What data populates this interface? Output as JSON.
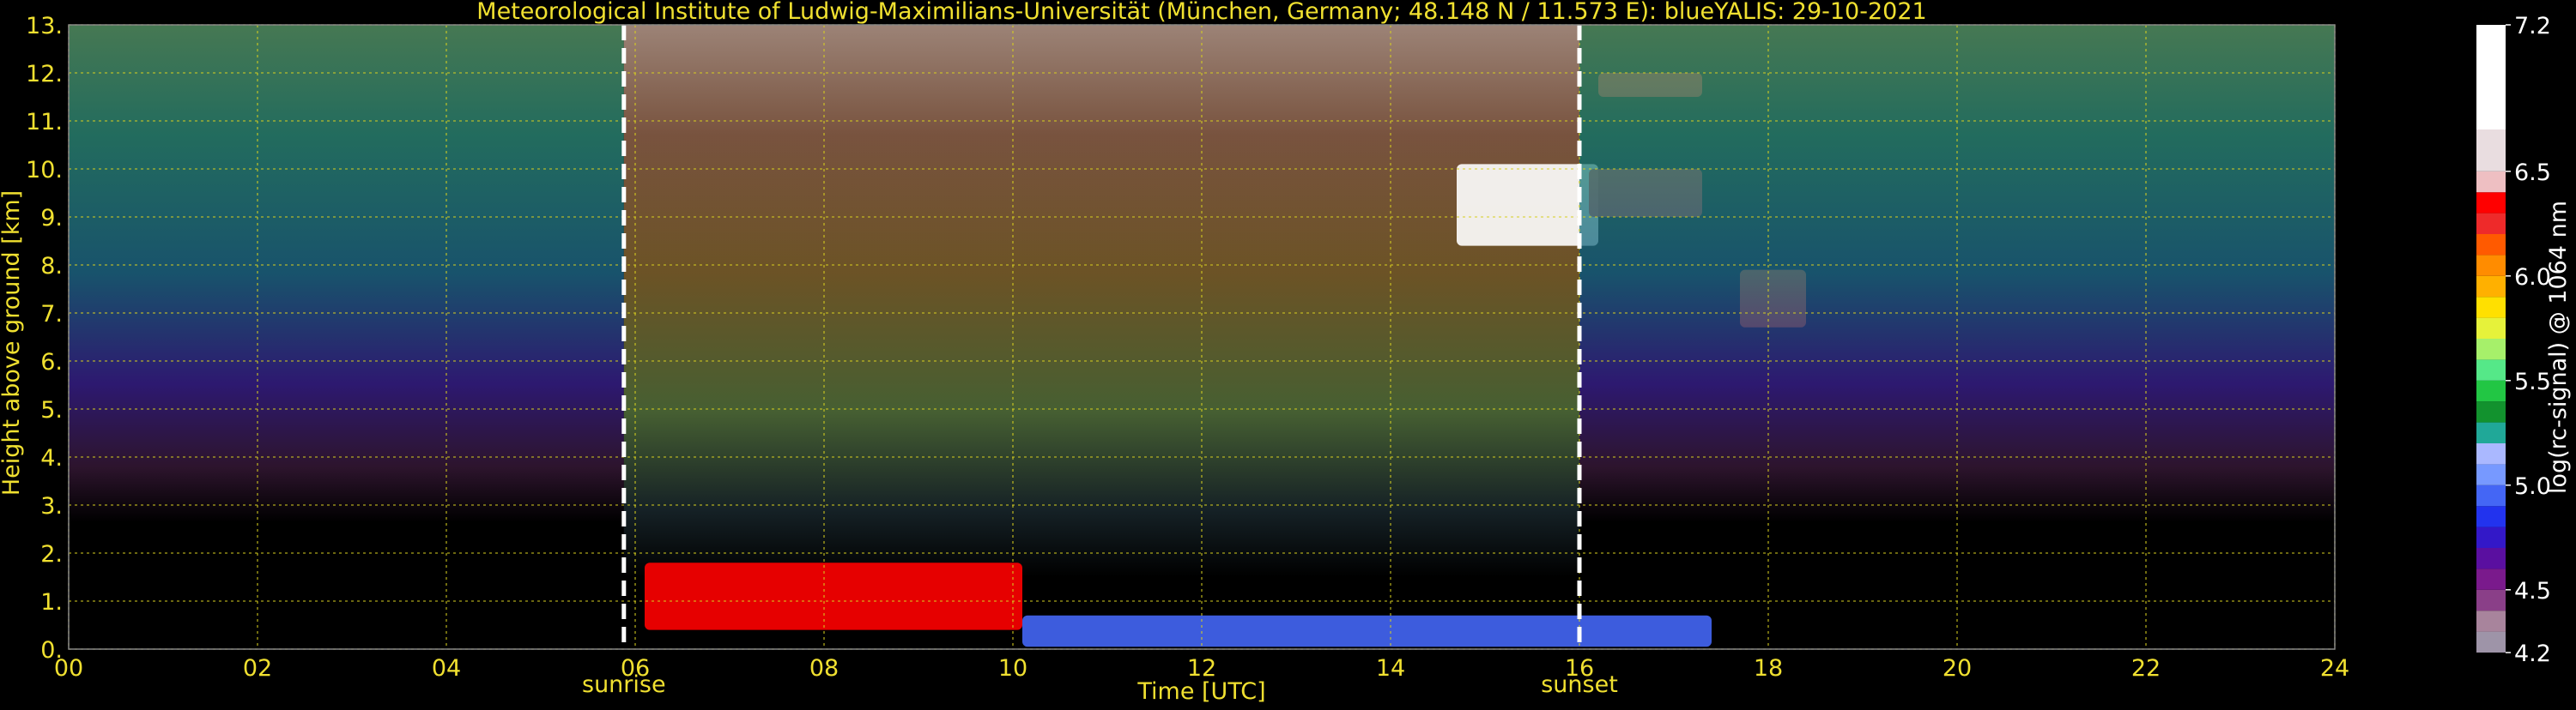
{
  "chart_data": {
    "type": "heatmap",
    "title": "Meteorological Institute of Ludwig-Maximilians-Universität (München, Germany; 48.148 N / 11.573 E):     blueYALIS: 29-10-2021",
    "xlabel": "Time [UTC]",
    "ylabel": "Height above ground [km]",
    "xlim": [
      0,
      24
    ],
    "ylim": [
      0,
      13
    ],
    "x_ticks": [
      "00",
      "02",
      "04",
      "06",
      "08",
      "10",
      "12",
      "14",
      "16",
      "18",
      "20",
      "22",
      "24"
    ],
    "x_tick_values": [
      0,
      2,
      4,
      6,
      8,
      10,
      12,
      14,
      16,
      18,
      20,
      22,
      24
    ],
    "y_ticks": [
      "0.",
      "1.",
      "2.",
      "3.",
      "4.",
      "5.",
      "6.",
      "7.",
      "8.",
      "9.",
      "10.",
      "11.",
      "12.",
      "13."
    ],
    "y_tick_values": [
      0,
      1,
      2,
      3,
      4,
      5,
      6,
      7,
      8,
      9,
      10,
      11,
      12,
      13
    ],
    "grid": true,
    "events": [
      {
        "label": "sunrise",
        "time": 5.88
      },
      {
        "label": "sunset",
        "time": 16.0
      }
    ],
    "colorbar": {
      "label": "log(rc-signal) @ 1064 nm",
      "range": [
        4.2,
        7.2
      ],
      "tick_labels": [
        "4.2",
        "4.5",
        "5.0",
        "5.5",
        "6.0",
        "6.5",
        "7.2"
      ],
      "tick_values": [
        4.2,
        4.5,
        5.0,
        5.5,
        6.0,
        6.5,
        7.2
      ],
      "levels": [
        {
          "from": 4.2,
          "to": 4.3,
          "color": "#9e94a8"
        },
        {
          "from": 4.3,
          "to": 4.4,
          "color": "#a8849c"
        },
        {
          "from": 4.4,
          "to": 4.5,
          "color": "#8a3f88"
        },
        {
          "from": 4.5,
          "to": 4.6,
          "color": "#7a1a8c"
        },
        {
          "from": 4.6,
          "to": 4.7,
          "color": "#5a0fa0"
        },
        {
          "from": 4.7,
          "to": 4.8,
          "color": "#3318c8"
        },
        {
          "from": 4.8,
          "to": 4.9,
          "color": "#2233ee"
        },
        {
          "from": 4.9,
          "to": 5.0,
          "color": "#4466f5"
        },
        {
          "from": 5.0,
          "to": 5.1,
          "color": "#7799ff"
        },
        {
          "from": 5.1,
          "to": 5.2,
          "color": "#aab8ff"
        },
        {
          "from": 5.2,
          "to": 5.3,
          "color": "#20a898"
        },
        {
          "from": 5.3,
          "to": 5.4,
          "color": "#12922e"
        },
        {
          "from": 5.4,
          "to": 5.5,
          "color": "#22c644"
        },
        {
          "from": 5.5,
          "to": 5.6,
          "color": "#55e888"
        },
        {
          "from": 5.6,
          "to": 5.7,
          "color": "#a6f06a"
        },
        {
          "from": 5.7,
          "to": 5.8,
          "color": "#e6f23a"
        },
        {
          "from": 5.8,
          "to": 5.9,
          "color": "#ffe000"
        },
        {
          "from": 5.9,
          "to": 6.0,
          "color": "#ffb000"
        },
        {
          "from": 6.0,
          "to": 6.1,
          "color": "#ff8c00"
        },
        {
          "from": 6.1,
          "to": 6.2,
          "color": "#ff5a00"
        },
        {
          "from": 6.2,
          "to": 6.3,
          "color": "#ee2a2a"
        },
        {
          "from": 6.3,
          "to": 6.4,
          "color": "#ff0000"
        },
        {
          "from": 6.4,
          "to": 6.5,
          "color": "#eebfc2"
        },
        {
          "from": 6.5,
          "to": 6.7,
          "color": "#e9dde0"
        },
        {
          "from": 6.7,
          "to": 7.2,
          "color": "#ffffff"
        }
      ]
    },
    "features": [
      {
        "name": "residual-noise-night-early",
        "t0": 0.0,
        "t1": 5.88,
        "h0": 1.5,
        "h1": 13.0,
        "kind": "background"
      },
      {
        "name": "daylight-background",
        "t0": 5.88,
        "t1": 16.0,
        "h0": 1.5,
        "h1": 13.0,
        "kind": "background"
      },
      {
        "name": "boundary-layer-aerosol",
        "t0": 6.1,
        "t1": 10.1,
        "h0": 0.4,
        "h1": 1.8,
        "value_max": 6.4
      },
      {
        "name": "near-ground-layer",
        "t0": 10.1,
        "t1": 17.4,
        "h0": 0.05,
        "h1": 0.7,
        "value_max": 5.0
      },
      {
        "name": "cirrus-cloud",
        "t0": 14.7,
        "t1": 16.2,
        "h0": 8.4,
        "h1": 10.1,
        "value_max": 7.2
      },
      {
        "name": "cirrus-cloud-upper",
        "t0": 16.2,
        "t1": 17.3,
        "h0": 11.5,
        "h1": 12.0,
        "value_max": 6.3
      },
      {
        "name": "cirrus-cloud-mid",
        "t0": 16.1,
        "t1": 17.3,
        "h0": 9.0,
        "h1": 10.0,
        "value_max": 6.3
      },
      {
        "name": "cloud-patch-7km",
        "t0": 17.7,
        "t1": 18.4,
        "h0": 6.7,
        "h1": 7.9,
        "value_max": 6.2
      },
      {
        "name": "residual-noise-night-late",
        "t0": 16.0,
        "t1": 24.0,
        "h0": 1.5,
        "h1": 13.0,
        "kind": "background"
      }
    ]
  }
}
